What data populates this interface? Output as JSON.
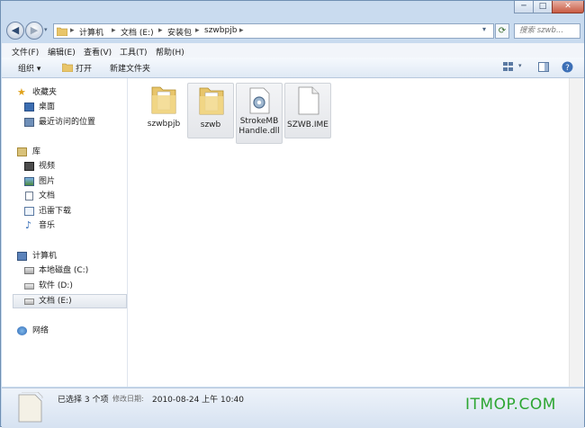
{
  "window_controls": {
    "minimize": "─",
    "maximize": "□",
    "close": "✕"
  },
  "navigation": {
    "back": "◀",
    "forward": "▶"
  },
  "address": {
    "crumbs": [
      "计算机",
      "文档 (E:)",
      "安装包",
      "szwbpjb"
    ],
    "separator": "▸"
  },
  "search": {
    "placeholder": "搜索 szwb..."
  },
  "menu": [
    "文件(F)",
    "编辑(E)",
    "查看(V)",
    "工具(T)",
    "帮助(H)"
  ],
  "toolbar": {
    "organize": "组织 ▾",
    "open": "打开",
    "new_folder": "新建文件夹"
  },
  "sidebar": {
    "favorites": {
      "label": "收藏夹",
      "items": [
        "桌面",
        "最近访问的位置"
      ]
    },
    "libraries": {
      "label": "库",
      "items": [
        "视频",
        "图片",
        "文档",
        "迅雷下载",
        "音乐"
      ]
    },
    "computer": {
      "label": "计算机",
      "items": [
        "本地磁盘 (C:)",
        "软件 (D:)",
        "文档 (E:)"
      ]
    },
    "network": {
      "label": "网络"
    }
  },
  "files": [
    {
      "name": "szwbpjb",
      "type": "folder"
    },
    {
      "name": "szwb",
      "type": "folder"
    },
    {
      "name": "StrokeMBHandle.dll",
      "line1": "StrokeMB",
      "line2": "Handle.dll",
      "type": "dll"
    },
    {
      "name": "SZWB.IME",
      "type": "file"
    }
  ],
  "status": {
    "selected": "已选择 3 个项",
    "modified_label": "修改日期:",
    "modified_value": "2010-08-24 上午 10:40"
  },
  "watermark": "ITMOP.COM",
  "colors": {
    "accent": "#2da632",
    "folder": "#e8c56a"
  }
}
